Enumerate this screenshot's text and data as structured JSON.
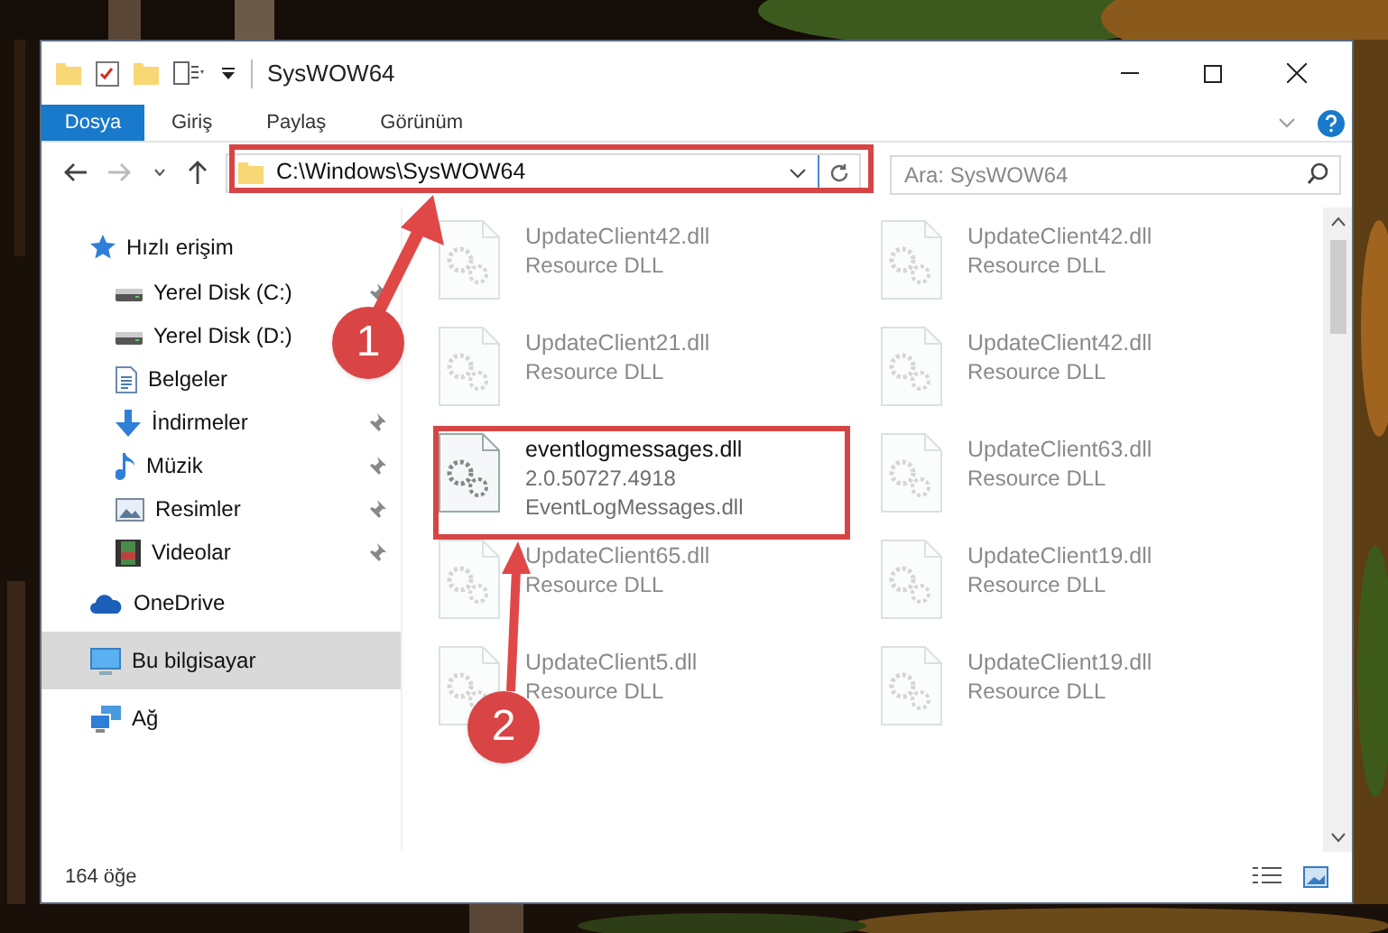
{
  "window": {
    "title": "SysWOW64"
  },
  "ribbon_tabs": [
    {
      "label": "Dosya",
      "selected": true
    },
    {
      "label": "Giriş",
      "selected": false
    },
    {
      "label": "Paylaş",
      "selected": false
    },
    {
      "label": "Görünüm",
      "selected": false
    }
  ],
  "address": {
    "path": "C:\\Windows\\SysWOW64"
  },
  "search": {
    "placeholder": "Ara: SysWOW64"
  },
  "sidebar": {
    "items": [
      {
        "label": "Hızlı erişim",
        "kind": "star",
        "selected": false,
        "children": [
          {
            "label": "Yerel Disk (C:)",
            "kind": "drive",
            "pinned": true,
            "selected": false
          },
          {
            "label": "Yerel Disk (D:)",
            "kind": "drive",
            "pinned": false,
            "selected": false
          },
          {
            "label": "Belgeler",
            "kind": "documents",
            "pinned": false,
            "selected": false
          },
          {
            "label": "İndirmeler",
            "kind": "downloads",
            "pinned": true,
            "selected": false
          },
          {
            "label": "Müzik",
            "kind": "music",
            "pinned": true,
            "selected": false
          },
          {
            "label": "Resimler",
            "kind": "pictures",
            "pinned": true,
            "selected": false
          },
          {
            "label": "Videolar",
            "kind": "videos",
            "pinned": true,
            "selected": false
          }
        ]
      },
      {
        "label": "OneDrive",
        "kind": "cloud",
        "selected": false
      },
      {
        "label": "Bu bilgisayar",
        "kind": "computer",
        "selected": true
      },
      {
        "label": "Ağ",
        "kind": "network",
        "selected": false
      }
    ]
  },
  "files": [
    {
      "name": "UpdateClient42.dll",
      "line_2": "Resource DLL",
      "blurred": true
    },
    {
      "name": "UpdateClient42.dll",
      "line_2": "Resource DLL",
      "blurred": true
    },
    {
      "name": "UpdateClient21.dll",
      "line_2": "Resource DLL",
      "blurred": true
    },
    {
      "name": "UpdateClient42.dll",
      "line_2": "Resource DLL",
      "blurred": true
    },
    {
      "name": "eventlogmessages.dll",
      "line_2": "2.0.50727.4918",
      "line_3": "EventLogMessages.dll",
      "blurred": false
    },
    {
      "name": "UpdateClient63.dll",
      "line_2": "Resource DLL",
      "blurred": true
    },
    {
      "name": "UpdateClient65.dll",
      "line_2": "Resource DLL",
      "blurred": true
    },
    {
      "name": "UpdateClient19.dll",
      "line_2": "Resource DLL",
      "blurred": true
    },
    {
      "name": "UpdateClient5.dll",
      "line_2": "Resource DLL",
      "blurred": true
    },
    {
      "name": "UpdateClient19.dll",
      "line_2": "Resource DLL",
      "blurred": true
    }
  ],
  "annotations": [
    {
      "number": "1"
    },
    {
      "number": "2"
    }
  ],
  "status_bar": {
    "count": "164 öğe"
  }
}
